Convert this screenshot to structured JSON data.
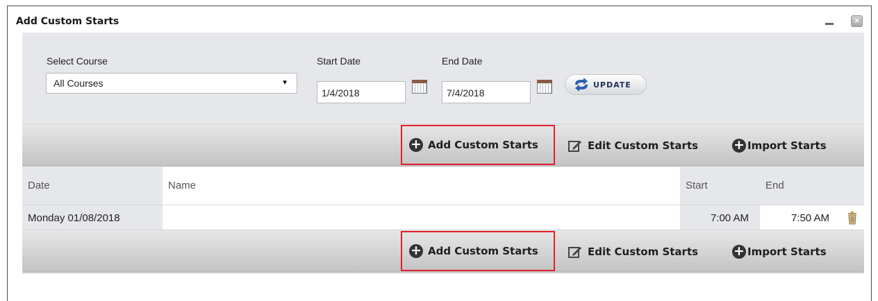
{
  "window": {
    "title": "Add Custom Starts",
    "close_glyph": "×"
  },
  "filters": {
    "course_label": "Select Course",
    "course_value": "All Courses",
    "start_date_label": "Start Date",
    "start_date_value": "1/4/2018",
    "end_date_label": "End Date",
    "end_date_value": "7/4/2018",
    "update_label": "UPDATE"
  },
  "toolbar": {
    "add_label": "Add Custom Starts",
    "edit_label": "Edit Custom Starts",
    "import_label": "Import Starts",
    "plus_glyph": "+"
  },
  "table": {
    "headers": {
      "date": "Date",
      "name": "Name",
      "start": "Start",
      "end": "End"
    },
    "rows": [
      {
        "date": "Monday 01/08/2018",
        "name": "",
        "start": "7:00 AM",
        "end": "7:50 AM"
      }
    ]
  },
  "colors": {
    "highlight": "#e21e2b",
    "panel_bg": "#e6e7eb",
    "update_text": "#22305e"
  },
  "icons": {
    "plus": "plus-circle-icon",
    "edit": "edit-icon",
    "calendar": "calendar-icon",
    "update": "refresh-icon",
    "trash": "trash-icon"
  }
}
